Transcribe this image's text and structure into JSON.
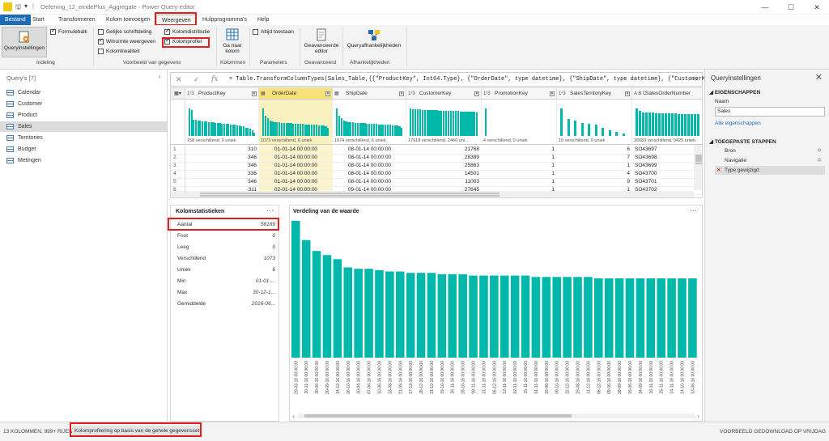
{
  "window": {
    "title": "Oefening_12_eindePlus_Aggregate - Power Query-editor",
    "controls": [
      "—",
      "☐",
      "✕"
    ]
  },
  "tabs": [
    "Bestand",
    "Start",
    "Transformeren",
    "Kolom toevoegen",
    "Weergeven",
    "Hulpprogramma's",
    "Help"
  ],
  "active_tab": "Weergeven",
  "ribbon": {
    "query_settings_label": "Queryinstellingen",
    "formula_bar_label": "Formulebalk",
    "layout_group": "Indeling",
    "monospace_label": "Gelijke schriftdeling",
    "whitespace_label": "Witruimte weergeven",
    "quality_label": "Kolomkwaliteit",
    "distribution_label": "Kolomdistributie",
    "profile_label": "Kolomprofiel",
    "preview_group": "Voorbeeld van gegevens",
    "goto_column_label": "Ga naar kolom",
    "columns_group": "Kolommen",
    "always_allow_label": "Altijd toestaan",
    "parameters_group": "Parameters",
    "advanced_editor_label": "Geavanceerde editor",
    "advanced_group": "Geavanceerd",
    "query_dependencies_label": "Queryafhankelijkheden",
    "dependencies_group": "Afhankelijkheden"
  },
  "queries": {
    "header": "Query's [7]",
    "items": [
      "Calendar",
      "Customer",
      "Product",
      "Sales",
      "Territories",
      "Budget",
      "Metingen"
    ],
    "selected": "Sales"
  },
  "formula": "= Table.TransformColumnTypes(Sales_Table,{{\"ProductKey\", Int64.Type}, {\"OrderDate\", type datetime}, {\"ShipDate\", type datetime}, {\"CustomerKey\",",
  "grid": {
    "columns": [
      {
        "type": "1²3",
        "name": "ProductKey",
        "profile": "158 verschillend, 0 uniek"
      },
      {
        "type": "▦",
        "name": "OrderDate",
        "profile": "1073 verschillend, 6 uniek"
      },
      {
        "type": "▦",
        "name": "ShipDate",
        "profile": "1074 verschillend, 6 uniek"
      },
      {
        "type": "1²3",
        "name": "CustomerKey",
        "profile": "17918 verschillend, 2466 uni..."
      },
      {
        "type": "1²3",
        "name": "PromotionKey",
        "profile": "4 verschillend, 0 uniek"
      },
      {
        "type": "1²3",
        "name": "SalesTerritoryKey",
        "profile": "10 verschillend, 0 uniek"
      },
      {
        "type": "A B C",
        "name": "SalesOrderNumber",
        "profile": "26683 verschillend, 9425 uniek"
      }
    ],
    "rows": [
      [
        "1",
        "310",
        "01-01-14 00:00:00",
        "08-01-14 00:00:00",
        "21768",
        "1",
        "6",
        "SO43697"
      ],
      [
        "2",
        "346",
        "01-01-14 00:00:00",
        "08-01-14 00:00:00",
        "28389",
        "1",
        "7",
        "SO43698"
      ],
      [
        "3",
        "346",
        "01-01-14 00:00:00",
        "08-01-14 00:00:00",
        "25863",
        "1",
        "1",
        "SO43699"
      ],
      [
        "4",
        "336",
        "01-01-14 00:00:00",
        "08-01-14 00:00:00",
        "14501",
        "1",
        "4",
        "SO43700"
      ],
      [
        "5",
        "346",
        "01-01-14 00:00:00",
        "08-01-14 00:00:00",
        "11003",
        "1",
        "9",
        "SO43701"
      ],
      [
        "6",
        "311",
        "02-01-14 00:00:00",
        "09-01-14 00:00:00",
        "27645",
        "1",
        "1",
        "SO43702"
      ]
    ]
  },
  "stats": {
    "header": "Kolomstatistieken",
    "rows": [
      {
        "k": "Aantal",
        "v": "58189"
      },
      {
        "k": "Fout",
        "v": "0"
      },
      {
        "k": "Leeg",
        "v": "0"
      },
      {
        "k": "Verschillend",
        "v": "1073"
      },
      {
        "k": "Uniek",
        "v": "6"
      },
      {
        "k": "Min",
        "v": "01-01-..."
      },
      {
        "k": "Max",
        "v": "30-12-1..."
      },
      {
        "k": "Gemiddelde",
        "v": "2016-06..."
      }
    ]
  },
  "distribution": {
    "header": "Verdeling van de waarde",
    "more": "···"
  },
  "chart_data": {
    "type": "bar",
    "title": "Verdeling van de waarde",
    "categories": [
      "29-02-16 00:00:00",
      "30-11-16 00:00:00",
      "30-06-16 00:00:00",
      "30-09-16 00:00:00",
      "14-12-16 00:00:00",
      "26-10-16 00:00:00",
      "30-04-16 00:00:00",
      "07-06-16 00:00:00",
      "10-06-16 00:00:00",
      "23-08-16 00:00:00",
      "21-09-16 00:00:00",
      "17-12-16 00:00:00",
      "28-12-16 00:00:00",
      "31-12-16 00:00:00",
      "19-10-16 00:00:00",
      "26-11-16 00:00:00",
      "28-10-16 00:00:00",
      "08-11-16 00:00:00",
      "21-11-16 00:00:00",
      "06-12-16 00:00:00",
      "12-11-16 00:00:00",
      "02-11-16 00:00:00",
      "15-11-16 00:00:00",
      "01-11-16 00:00:00",
      "18-08-16 00:00:00",
      "09-10-16 00:00:00",
      "22-12-16 00:00:00",
      "19-08-16 00:00:00",
      "11-12-16 00:00:00",
      "08-12-16 00:00:00",
      "09-06-16 00:00:00",
      "28-09-16 00:00:00",
      "15-06-16 00:00:00",
      "14-09-16 00:00:00",
      "16-11-16 00:00:00",
      "25-11-16 00:00:00",
      "24-11-16 00:00:00",
      "14-10-16 00:00:00",
      "13-06-16 00:00:00"
    ],
    "values": [
      100,
      86,
      78,
      75,
      72,
      66,
      65,
      65,
      64,
      63,
      63,
      62,
      62,
      62,
      61,
      61,
      61,
      60,
      60,
      60,
      60,
      60,
      60,
      59,
      59,
      59,
      59,
      59,
      59,
      58,
      58,
      58,
      58,
      58,
      58,
      58,
      58,
      58,
      58
    ],
    "ylim": [
      0,
      100
    ],
    "color": "#01b8aa",
    "grid": false
  },
  "settings": {
    "title": "Queryinstellingen",
    "properties_header": "EIGENSCHAPPEN",
    "name_label": "Naam",
    "name_value": "Sales",
    "all_properties": "Alle eigenschappen",
    "steps_header": "TOEGEPASTE STAPPEN",
    "steps": [
      "Bron",
      "Navigatie",
      "Type gewijzigd"
    ],
    "selected_step": "Type gewijzigd"
  },
  "status": {
    "left": "13 KOLOMMEN, 999+ RIJEN",
    "profiling": "Kolomprofilering op basis van de gehele gegevensset",
    "right": "VOORBEELD GEDOWNLOAD OP VRIJDAG"
  },
  "colors": {
    "accent": "#1d6bb5",
    "bar": "#01b8aa",
    "highlight": "#e02020",
    "selected_col": "#f7e27a"
  }
}
